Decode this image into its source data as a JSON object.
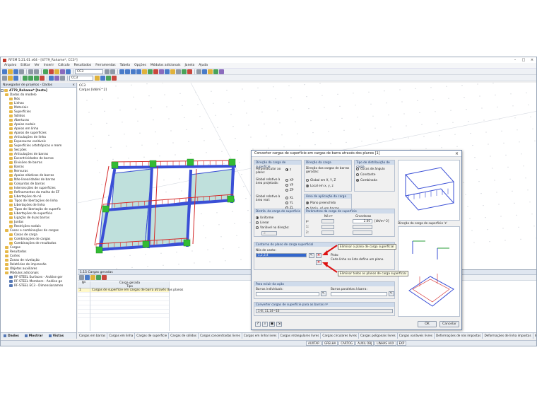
{
  "window": {
    "title": "RFEM 5.21.01 x64 - [4779_Rahame*, CC3*]",
    "controls": [
      "–",
      "□",
      "×"
    ]
  },
  "menu": {
    "items": [
      "Arquivo",
      "Editar",
      "Ver",
      "Inserir",
      "Cálculo",
      "Resultados",
      "Ferramentas",
      "Tabela",
      "Opções",
      "Módulos adicionais",
      "Janela",
      "Ajuda"
    ]
  },
  "toolbar": {
    "combo_loadcase": "CC3",
    "combo_right": "CC3"
  },
  "navigator": {
    "title": "Navegador de projetos - Dados",
    "close": "×",
    "root": "4779_Rahame* [teste]",
    "items": [
      {
        "label": "Dados do modelo",
        "level": 1,
        "icon": "folder"
      },
      {
        "label": "Nós",
        "level": 2,
        "icon": "folder"
      },
      {
        "label": "Linhas",
        "level": 2,
        "icon": "folder"
      },
      {
        "label": "Materiais",
        "level": 2,
        "icon": "folder"
      },
      {
        "label": "Superfícies",
        "level": 2,
        "icon": "folder"
      },
      {
        "label": "Sólidos",
        "level": 2,
        "icon": "folder"
      },
      {
        "label": "Aberturas",
        "level": 2,
        "icon": "folder"
      },
      {
        "label": "Apoios nodais",
        "level": 2,
        "icon": "folder"
      },
      {
        "label": "Apoios em linha",
        "level": 2,
        "icon": "folder"
      },
      {
        "label": "Apoios de superfícies",
        "level": 2,
        "icon": "folder"
      },
      {
        "label": "Articulações de linha",
        "level": 2,
        "icon": "folder"
      },
      {
        "label": "Espessuras variáveis",
        "level": 2,
        "icon": "folder"
      },
      {
        "label": "Superfícies ortotrópicas e mem",
        "level": 2,
        "icon": "folder"
      },
      {
        "label": "Secções",
        "level": 2,
        "icon": "folder"
      },
      {
        "label": "Articulações de barras",
        "level": 2,
        "icon": "folder"
      },
      {
        "label": "Excentricidades de barras",
        "level": 2,
        "icon": "folder"
      },
      {
        "label": "Divisões de barras",
        "level": 2,
        "icon": "folder"
      },
      {
        "label": "Barras",
        "level": 2,
        "icon": "folder"
      },
      {
        "label": "Nervuras",
        "level": 2,
        "icon": "folder"
      },
      {
        "label": "Apoios elásticos de barras",
        "level": 2,
        "icon": "folder"
      },
      {
        "label": "Não-linearidades de barras",
        "level": 2,
        "icon": "folder"
      },
      {
        "label": "Conjuntos de barras",
        "level": 2,
        "icon": "folder"
      },
      {
        "label": "Intersecções de superfícies",
        "level": 2,
        "icon": "folder"
      },
      {
        "label": "Refinamentos da malha de EF",
        "level": 2,
        "icon": "folder"
      },
      {
        "label": "Libertações do nó",
        "level": 2,
        "icon": "folder"
      },
      {
        "label": "Tipos de libertações de linha",
        "level": 2,
        "icon": "folder"
      },
      {
        "label": "Libertações de linha",
        "level": 2,
        "icon": "folder"
      },
      {
        "label": "Tipos de libertação de superfíc",
        "level": 2,
        "icon": "folder"
      },
      {
        "label": "Libertações de superfície",
        "level": 2,
        "icon": "folder"
      },
      {
        "label": "Ligação de duas barras",
        "level": 2,
        "icon": "folder"
      },
      {
        "label": "Juntas",
        "level": 2,
        "icon": "folder"
      },
      {
        "label": "Restrições nodais",
        "level": 2,
        "icon": "folder"
      },
      {
        "label": "Casos e combinações de cargas",
        "level": 1,
        "icon": "folder"
      },
      {
        "label": "Casos de carga",
        "level": 2,
        "icon": "folder"
      },
      {
        "label": "Combinações de cargas",
        "level": 2,
        "icon": "folder"
      },
      {
        "label": "Combinações de resultados",
        "level": 2,
        "icon": "folder"
      },
      {
        "label": "Cargas",
        "level": 1,
        "icon": "folder"
      },
      {
        "label": "Resultados",
        "level": 1,
        "icon": "folder"
      },
      {
        "label": "Cortes",
        "level": 1,
        "icon": "folder"
      },
      {
        "label": "Zonas de nivelação",
        "level": 1,
        "icon": "folder"
      },
      {
        "label": "Relatórios de impressão",
        "level": 1,
        "icon": "folder"
      },
      {
        "label": "Objetos auxiliares",
        "level": 1,
        "icon": "folder"
      },
      {
        "label": "Módulos adicionais",
        "level": 1,
        "icon": "folder"
      },
      {
        "label": "RF-STEEL Surfaces - Análise ger",
        "level": 2,
        "icon": "module"
      },
      {
        "label": "RF-STEEL Members - Análise ge",
        "level": 2,
        "icon": "module"
      },
      {
        "label": "RF-STEEL EC3 - Dimensionamen",
        "level": 2,
        "icon": "module"
      }
    ],
    "tabs": [
      "Dados",
      "Mostrar",
      "Vistas"
    ]
  },
  "view": {
    "label_cc": "CC3",
    "label_loads": "Cargas [kN/m^2]"
  },
  "table": {
    "title": "1.15 Cargas geradas",
    "close": "×",
    "columns": [
      {
        "top": "",
        "bottom": "Nº"
      },
      {
        "top": "Carga gerada",
        "bottom": "Tipo"
      }
    ],
    "rows": [
      {
        "no": "1",
        "type": "Cargas de superfície em cargas de barra através dos planos",
        "selected": true
      },
      {
        "no": "",
        "type": "",
        "selected": false
      },
      {
        "no": "",
        "type": "",
        "selected": false
      },
      {
        "no": "",
        "type": "",
        "selected": false
      },
      {
        "no": "",
        "type": "",
        "selected": false
      },
      {
        "no": "",
        "type": "",
        "selected": false
      },
      {
        "no": "",
        "type": "",
        "selected": false
      }
    ],
    "sheets": [
      "Cargas em barras",
      "Cargas em linha",
      "Cargas de superfície",
      "Cargas de sólidos",
      "Cargas concentradas livres",
      "Cargas em linha livres",
      "Cargas retangulares livres",
      "Cargas circulares livres",
      "Cargas poligonais livres",
      "Cargas variáveis livres",
      "Deformações de nós impostas",
      "Deformações de linha impostas",
      "Imperfeições",
      "Cargas geradas"
    ],
    "active_sheet": "Cargas geradas"
  },
  "statusbar": {
    "items": [
      "AUXTAR",
      "GRELHA",
      "CARTOG",
      "AUXIL OBJ",
      "LINHAS AUX",
      "EXP"
    ]
  },
  "dialog": {
    "title": "Converter cargas de superfície em cargas de barra através dos planos  [1]",
    "close": "×",
    "dir_surface": {
      "title": "Direção da carga de superfície",
      "perp_label": "Perpendicular ao plano:",
      "global_label": "Global relativo à área projetada:",
      "global2_label": "Global relativo à área real:",
      "options": [
        "z",
        "XP",
        "YP",
        "ZP",
        "XL",
        "YL",
        "ZL"
      ],
      "selected": "z"
    },
    "dir_bar": {
      "title": "Direção da carga",
      "desc": "Direção das cargas de barras geradas:",
      "options": [
        "Global em X, Y, Z",
        "Local em x, y, z"
      ],
      "selected": "Local em x, y, z"
    },
    "distribution": {
      "title": "Tipo de distribuição de carga",
      "options": [
        "Cocos de ângulo",
        "Constante",
        "Combinada"
      ],
      "selected": "Combinada"
    },
    "area": {
      "title": "Área de aplicação da carga",
      "options": [
        "Plano preenchido",
        "Vazio, só em barras"
      ],
      "selected": "Plano preenchido"
    },
    "distrib_surf": {
      "title": "Distrib. da carga de superfície",
      "options": [
        "Uniforme",
        "Linear",
        "Variável na direção:"
      ],
      "selected": "Uniforme",
      "dir_value": "Z"
    },
    "param": {
      "title": "Parâmetros da carga de superfície",
      "col_node": "Nó nº",
      "col_size": "Grandezas",
      "p_label": "p:",
      "p_value": "2.00",
      "unit": "[kN/m^2]",
      "rows": [
        "1:",
        "2:",
        "3:"
      ]
    },
    "contour": {
      "title": "Contorno do plano de carga superficial",
      "nodes_label": "Nós de canto:",
      "nodes_value": "1,2,3,4",
      "hint_title": "Pista:",
      "hint": "Cada linha na lista define um plano."
    },
    "tooltip_remove": "Eliminar o plano de carga superficial",
    "tooltip_remove_all": "Eliminar todos os planos de carga superficial",
    "preview_label": "Direção da carga de superfície 'z'",
    "excluded": {
      "title": "Para ecluir da ação",
      "single_label": "Barras individuais:",
      "parallel_label": "Barras paralelas à barra:"
    },
    "generated": {
      "title": "Converter cargas de superfície para as barras nº",
      "value": "1-8; 11,14~16"
    },
    "ok": "OK",
    "cancel": "Cancelar"
  },
  "colors": {
    "accent": "#3366cc",
    "load_red": "#d42a2a",
    "member_blue": "#3a4fd6",
    "support_green": "#33bb33",
    "slab_fill": "#bfe0dc"
  }
}
